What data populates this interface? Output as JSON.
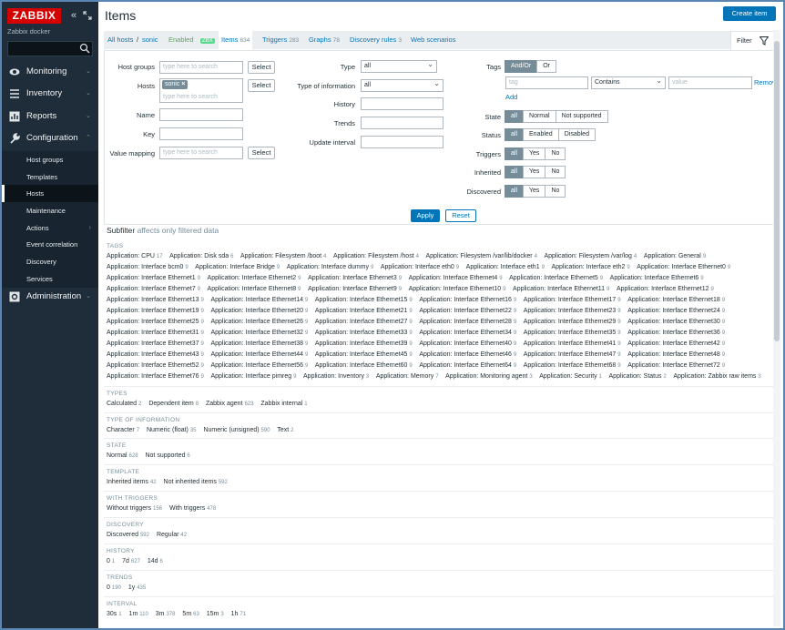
{
  "sidebar": {
    "logo": "ZABBIX",
    "server_name": "Zabbix docker",
    "search_placeholder": "",
    "menu": [
      {
        "label": "Monitoring",
        "icon": "eye-icon"
      },
      {
        "label": "Inventory",
        "icon": "list-icon"
      },
      {
        "label": "Reports",
        "icon": "chart-icon"
      },
      {
        "label": "Configuration",
        "icon": "wrench-icon"
      },
      {
        "label": "Administration",
        "icon": "gear-icon"
      }
    ],
    "config_sub": [
      "Host groups",
      "Templates",
      "Hosts",
      "Maintenance",
      "Actions",
      "Event correlation",
      "Discovery",
      "Services"
    ]
  },
  "header": {
    "title": "Items",
    "create_button": "Create item"
  },
  "nav": {
    "all_hosts": "All hosts",
    "separator": "/",
    "host": "sonic",
    "enabled": "Enabled",
    "zbx": "ZBX",
    "items": "Items",
    "items_count": "634",
    "triggers": "Triggers",
    "triggers_count": "283",
    "graphs": "Graphs",
    "graphs_count": "78",
    "discovery": "Discovery rules",
    "discovery_count": "3",
    "web": "Web scenarios",
    "filter_tab": "Filter"
  },
  "filter": {
    "host_groups_label": "Host groups",
    "hosts_label": "Hosts",
    "name_label": "Name",
    "key_label": "Key",
    "value_mapping_label": "Value mapping",
    "type_here": "type here to search",
    "select": "Select",
    "host_chip": "sonic",
    "type_label": "Type",
    "type_value": "all",
    "type_info_label": "Type of information",
    "type_info_value": "all",
    "history_label": "History",
    "trends_label": "Trends",
    "update_label": "Update interval",
    "tags_label": "Tags",
    "andor": "And/Or",
    "or": "Or",
    "tag_placeholder": "tag",
    "contains": "Contains",
    "value_placeholder": "value",
    "remove": "Remove",
    "add": "Add",
    "state_label": "State",
    "state_opts": [
      "all",
      "Normal",
      "Not supported"
    ],
    "status_label": "Status",
    "status_opts": [
      "all",
      "Enabled",
      "Disabled"
    ],
    "triggers_label": "Triggers",
    "inherited_label": "Inherited",
    "discovered_label": "Discovered",
    "yn_opts": [
      "all",
      "Yes",
      "No"
    ],
    "apply": "Apply",
    "reset": "Reset"
  },
  "subfilter": {
    "title": "Subfilter",
    "note": "affects only filtered data",
    "sections": [
      {
        "head": "TAGS",
        "items": [
          [
            "Application: CPU",
            "17"
          ],
          [
            "Application: Disk sda",
            "6"
          ],
          [
            "Application: Filesystem /boot",
            "4"
          ],
          [
            "Application: Filesystem /host",
            "4"
          ],
          [
            "Application: Filesystem /var/lib/docker",
            "4"
          ],
          [
            "Application: Filesystem /var/log",
            "4"
          ],
          [
            "Application: General",
            "9"
          ],
          [
            "Application: Interface bcm0",
            "9"
          ],
          [
            "Application: Interface Bridge",
            "9"
          ],
          [
            "Application: Interface dummy",
            "9"
          ],
          [
            "Application: Interface eth0",
            "9"
          ],
          [
            "Application: Interface eth1",
            "9"
          ],
          [
            "Application: Interface eth2",
            "9"
          ],
          [
            "Application: Interface Ethernet0",
            "9"
          ],
          [
            "Application: Interface Ethernet1",
            "9"
          ],
          [
            "Application: Interface Ethernet2",
            "9"
          ],
          [
            "Application: Interface Ethernet3",
            "9"
          ],
          [
            "Application: Interface Ethernet4",
            "9"
          ],
          [
            "Application: Interface Ethernet5",
            "9"
          ],
          [
            "Application: Interface Ethernet6",
            "9"
          ],
          [
            "Application: Interface Ethernet7",
            "9"
          ],
          [
            "Application: Interface Ethernet8",
            "9"
          ],
          [
            "Application: Interface Ethernet9",
            "9"
          ],
          [
            "Application: Interface Ethernet10",
            "9"
          ],
          [
            "Application: Interface Ethernet11",
            "9"
          ],
          [
            "Application: Interface Ethernet12",
            "9"
          ],
          [
            "Application: Interface Ethernet13",
            "9"
          ],
          [
            "Application: Interface Ethernet14",
            "9"
          ],
          [
            "Application: Interface Ethernet15",
            "9"
          ],
          [
            "Application: Interface Ethernet16",
            "9"
          ],
          [
            "Application: Interface Ethernet17",
            "9"
          ],
          [
            "Application: Interface Ethernet18",
            "9"
          ],
          [
            "Application: Interface Ethernet19",
            "9"
          ],
          [
            "Application: Interface Ethernet20",
            "9"
          ],
          [
            "Application: Interface Ethernet21",
            "9"
          ],
          [
            "Application: Interface Ethernet22",
            "9"
          ],
          [
            "Application: Interface Ethernet23",
            "9"
          ],
          [
            "Application: Interface Ethernet24",
            "9"
          ],
          [
            "Application: Interface Ethernet25",
            "9"
          ],
          [
            "Application: Interface Ethernet26",
            "9"
          ],
          [
            "Application: Interface Ethernet27",
            "9"
          ],
          [
            "Application: Interface Ethernet28",
            "9"
          ],
          [
            "Application: Interface Ethernet29",
            "9"
          ],
          [
            "Application: Interface Ethernet30",
            "9"
          ],
          [
            "Application: Interface Ethernet31",
            "9"
          ],
          [
            "Application: Interface Ethernet32",
            "9"
          ],
          [
            "Application: Interface Ethernet33",
            "9"
          ],
          [
            "Application: Interface Ethernet34",
            "9"
          ],
          [
            "Application: Interface Ethernet35",
            "9"
          ],
          [
            "Application: Interface Ethernet36",
            "9"
          ],
          [
            "Application: Interface Ethernet37",
            "9"
          ],
          [
            "Application: Interface Ethernet38",
            "9"
          ],
          [
            "Application: Interface Ethernet39",
            "9"
          ],
          [
            "Application: Interface Ethernet40",
            "9"
          ],
          [
            "Application: Interface Ethernet41",
            "9"
          ],
          [
            "Application: Interface Ethernet42",
            "9"
          ],
          [
            "Application: Interface Ethernet43",
            "9"
          ],
          [
            "Application: Interface Ethernet44",
            "9"
          ],
          [
            "Application: Interface Ethernet45",
            "9"
          ],
          [
            "Application: Interface Ethernet46",
            "9"
          ],
          [
            "Application: Interface Ethernet47",
            "9"
          ],
          [
            "Application: Interface Ethernet48",
            "9"
          ],
          [
            "Application: Interface Ethernet52",
            "9"
          ],
          [
            "Application: Interface Ethernet56",
            "9"
          ],
          [
            "Application: Interface Ethernet60",
            "9"
          ],
          [
            "Application: Interface Ethernet64",
            "9"
          ],
          [
            "Application: Interface Ethernet68",
            "9"
          ],
          [
            "Application: Interface Ethernet72",
            "9"
          ],
          [
            "Application: Interface Ethernet76",
            "9"
          ],
          [
            "Application: Interface pimreg",
            "9"
          ],
          [
            "Application: Inventory",
            "3"
          ],
          [
            "Application: Memory",
            "7"
          ],
          [
            "Application: Monitoring agent",
            "3"
          ],
          [
            "Application: Security",
            "1"
          ],
          [
            "Application: Status",
            "2"
          ],
          [
            "Application: Zabbix raw items",
            "3"
          ]
        ]
      },
      {
        "head": "TYPES",
        "items": [
          [
            "Calculated",
            "2"
          ],
          [
            "Dependent item",
            "8"
          ],
          [
            "Zabbix agent",
            "623"
          ],
          [
            "Zabbix internal",
            "1"
          ]
        ]
      },
      {
        "head": "TYPE OF INFORMATION",
        "items": [
          [
            "Character",
            "7"
          ],
          [
            "Numeric (float)",
            "35"
          ],
          [
            "Numeric (unsigned)",
            "590"
          ],
          [
            "Text",
            "2"
          ]
        ]
      },
      {
        "head": "STATE",
        "items": [
          [
            "Normal",
            "628"
          ],
          [
            "Not supported",
            "6"
          ]
        ]
      },
      {
        "head": "TEMPLATE",
        "items": [
          [
            "Inherited items",
            "42"
          ],
          [
            "Not inherited items",
            "592"
          ]
        ]
      },
      {
        "head": "WITH TRIGGERS",
        "items": [
          [
            "Without triggers",
            "156"
          ],
          [
            "With triggers",
            "478"
          ]
        ]
      },
      {
        "head": "DISCOVERY",
        "items": [
          [
            "Discovered",
            "592"
          ],
          [
            "Regular",
            "42"
          ]
        ]
      },
      {
        "head": "HISTORY",
        "items": [
          [
            "0",
            "1"
          ],
          [
            "7d",
            "627"
          ],
          [
            "14d",
            "6"
          ]
        ]
      },
      {
        "head": "TRENDS",
        "items": [
          [
            "0",
            "190"
          ],
          [
            "1y",
            "435"
          ]
        ]
      },
      {
        "head": "INTERVAL",
        "items": [
          [
            "30s",
            "1"
          ],
          [
            "1m",
            "110"
          ],
          [
            "3m",
            "378"
          ],
          [
            "5m",
            "63"
          ],
          [
            "15m",
            "3"
          ],
          [
            "1h",
            "71"
          ]
        ]
      }
    ]
  }
}
